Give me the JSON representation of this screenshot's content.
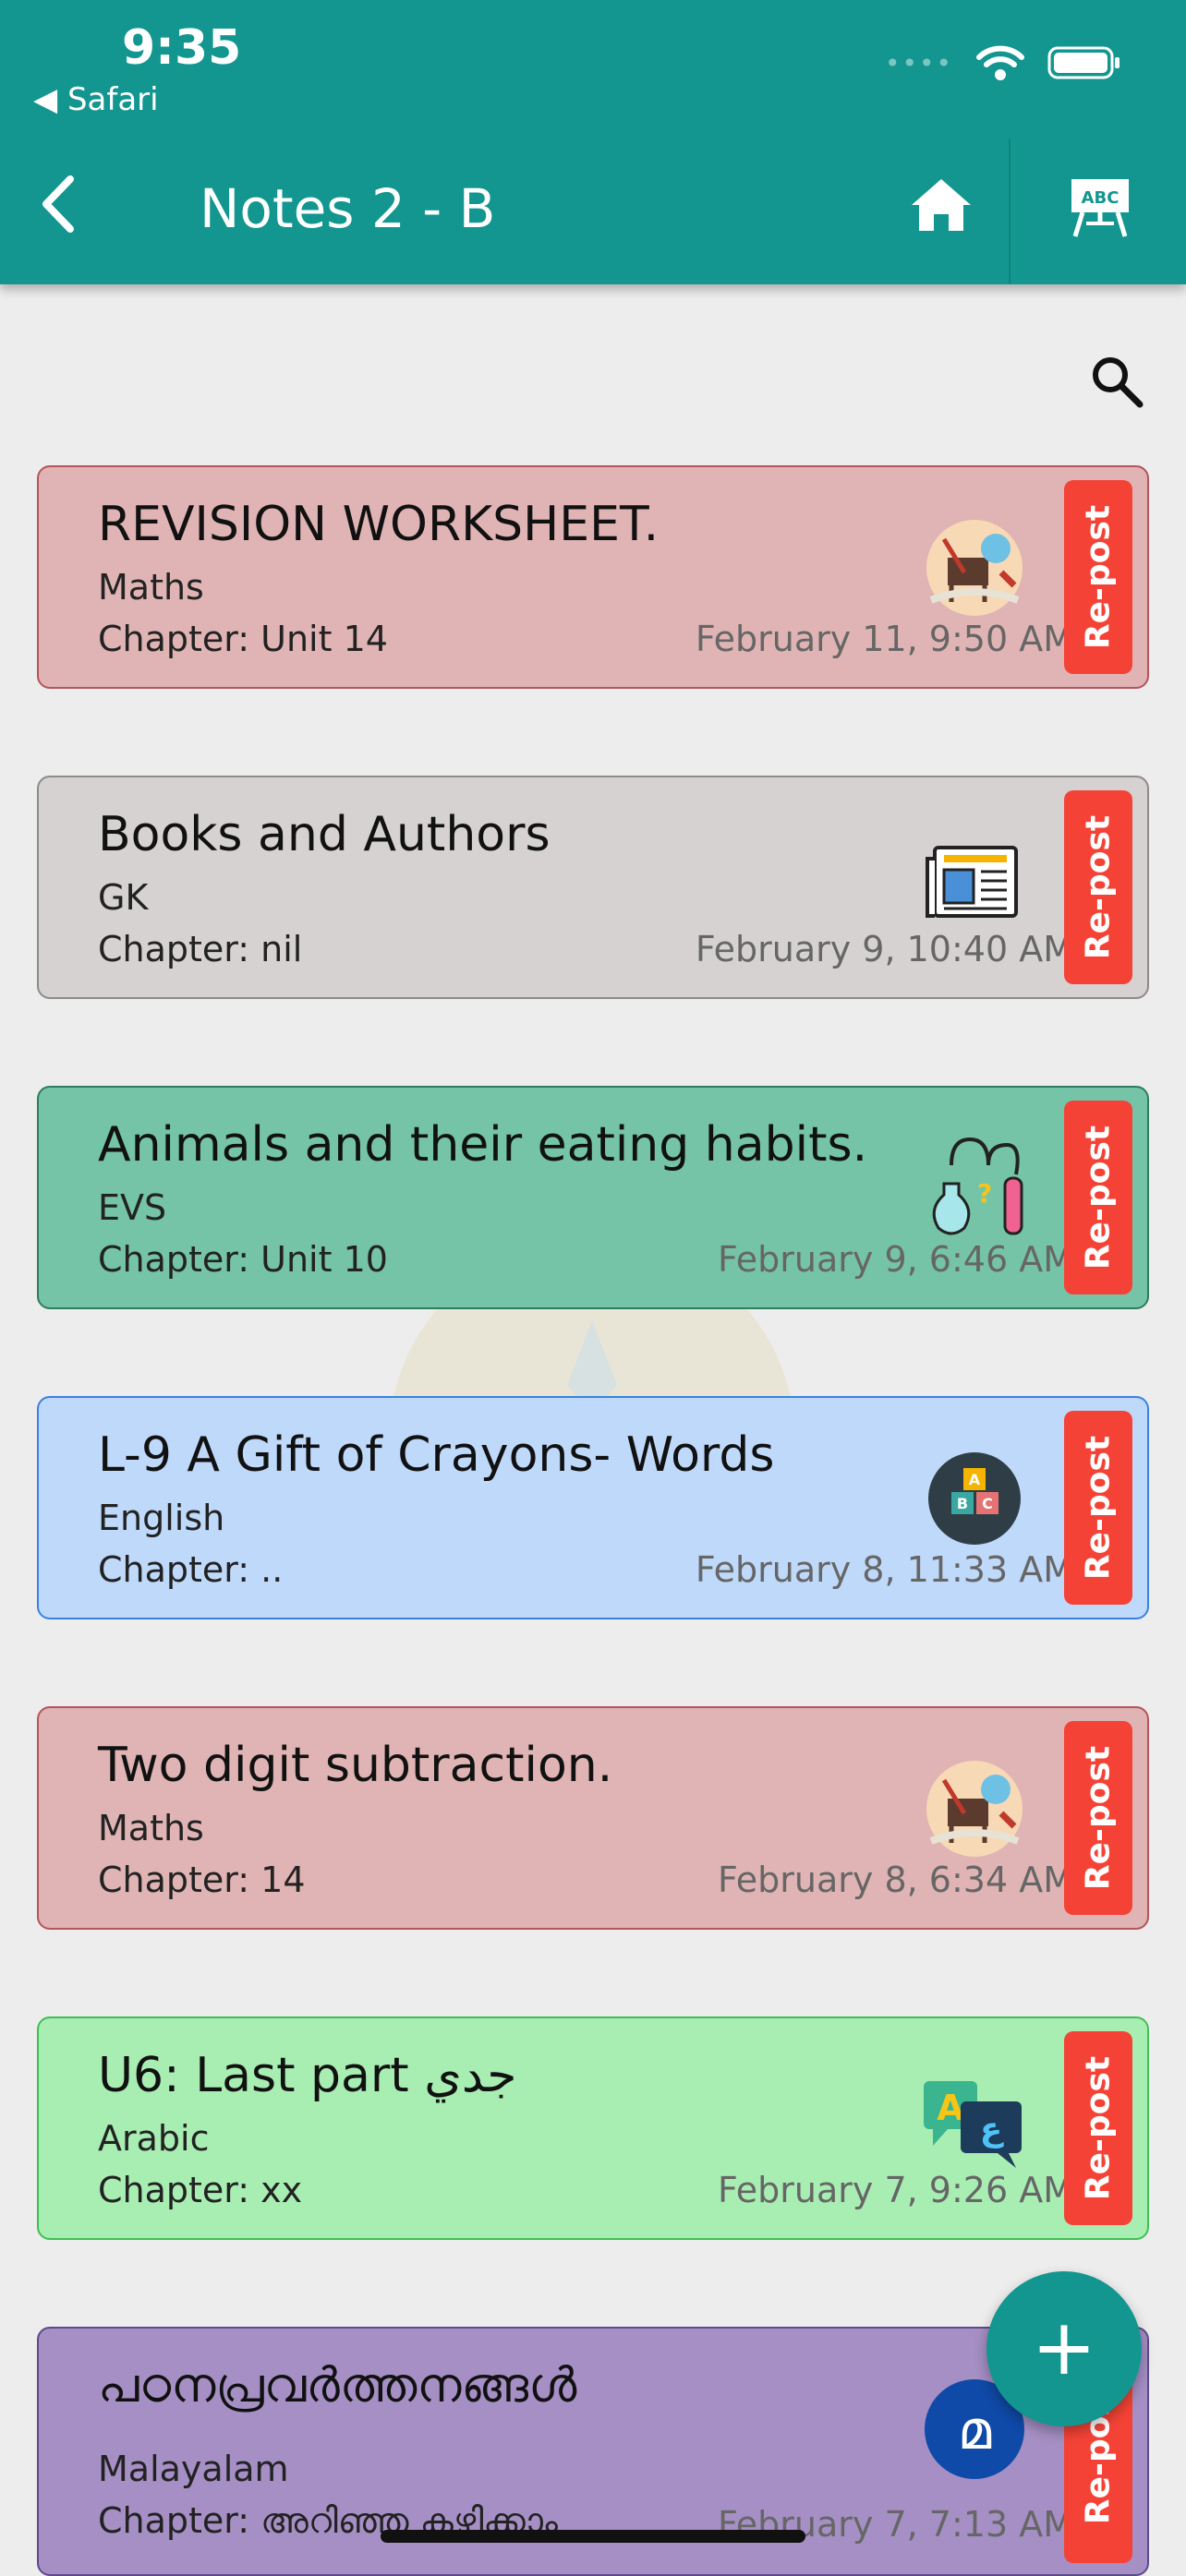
{
  "status_bar": {
    "time": "9:35",
    "back_app": "◀ Safari",
    "dots": "••••"
  },
  "header": {
    "title": "Notes  2 - B"
  },
  "cards": [
    {
      "title": "REVISION WORKSHEET.",
      "subject": "Maths",
      "chapter": "Chapter: Unit 14",
      "date": "February 11, 9:50 AM",
      "repost": "Re-post",
      "icon": "maths-icon",
      "bg": "#e0b4b4",
      "border": "#b5545a"
    },
    {
      "title": "Books and Authors",
      "subject": "GK",
      "chapter": "Chapter: nil",
      "date": "February 9, 10:40 AM",
      "repost": "Re-post",
      "icon": "newspaper-icon",
      "bg": "#d6d2d2",
      "border": "#8f8a8a"
    },
    {
      "title": "Animals and their eating habits.",
      "subject": "EVS",
      "chapter": "Chapter: Unit 10",
      "date": "February 9, 6:46 AM",
      "repost": "Re-post",
      "icon": "science-icon",
      "bg": "#75c4a8",
      "border": "#2e7d5f"
    },
    {
      "title": "L-9 A Gift of Crayons- Words",
      "subject": "English",
      "chapter": "Chapter: ..",
      "date": "February 8, 11:33 AM",
      "repost": "Re-post",
      "icon": "abc-blocks-icon",
      "bg": "#bfd9fb",
      "border": "#3b82e0"
    },
    {
      "title": "Two digit subtraction.",
      "subject": "Maths",
      "chapter": "Chapter: 14",
      "date": "February 8, 6:34 AM",
      "repost": "Re-post",
      "icon": "maths-icon",
      "bg": "#e0b4b4",
      "border": "#b5545a"
    },
    {
      "title": "U6: Last part جدي",
      "subject": "Arabic",
      "chapter": "Chapter: xx",
      "date": "February 7, 9:26 AM",
      "repost": "Re-post",
      "icon": "language-icon",
      "bg": "#a8eeb3",
      "border": "#3fbf56"
    },
    {
      "title": "പഠനപ്രവർത്തനങ്ങൾ",
      "subject": "Malayalam",
      "chapter": "Chapter: അറിഞ്ഞു കഴിക്കാം",
      "date": "February 7, 7:13 AM",
      "repost": "Re-post",
      "icon": "malayalam-letter-icon",
      "icon_glyph": "മ",
      "bg": "#a58fc4",
      "border": "#5e4a8a"
    }
  ],
  "fab": {
    "label": "+"
  },
  "colors": {
    "header": "#12968f",
    "repost": "#f44336",
    "background": "#ededed"
  }
}
